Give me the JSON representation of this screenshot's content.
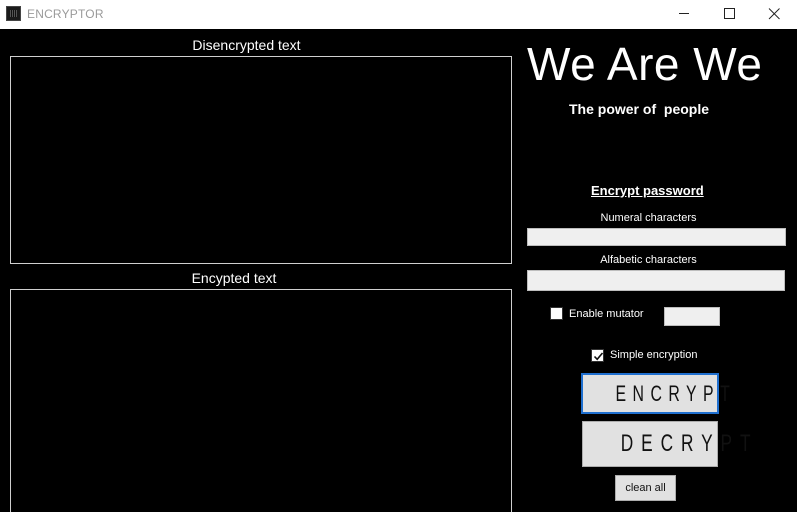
{
  "window": {
    "title": "ENCRYPTOR",
    "controls": {
      "minimize": "minimize-icon",
      "maximize": "maximize-icon",
      "close": "close-icon"
    }
  },
  "left": {
    "disencrypted_label": "Disencrypted text",
    "disencrypted_value": "",
    "encrypted_label": "Encypted text",
    "encrypted_value": ""
  },
  "header": {
    "title": "We Are We",
    "subtitle": "The power of  people"
  },
  "password": {
    "section_title": "Encrypt password",
    "numeral_label": "Numeral characters",
    "numeral_value": "",
    "alfabetic_label": "Alfabetic characters",
    "alfabetic_value": ""
  },
  "options": {
    "mutator_label": "Enable mutator",
    "mutator_checked": false,
    "mutator_value": "",
    "simple_label": "Simple encryption",
    "simple_checked": true
  },
  "buttons": {
    "encrypt": "ENCRYPT",
    "decrypt": "DECRYPT",
    "clean_all": "clean all"
  },
  "colors": {
    "background": "#000000",
    "text": "#ffffff",
    "button_face": "#e1e1e1",
    "focus_border": "#1f6fcf"
  }
}
